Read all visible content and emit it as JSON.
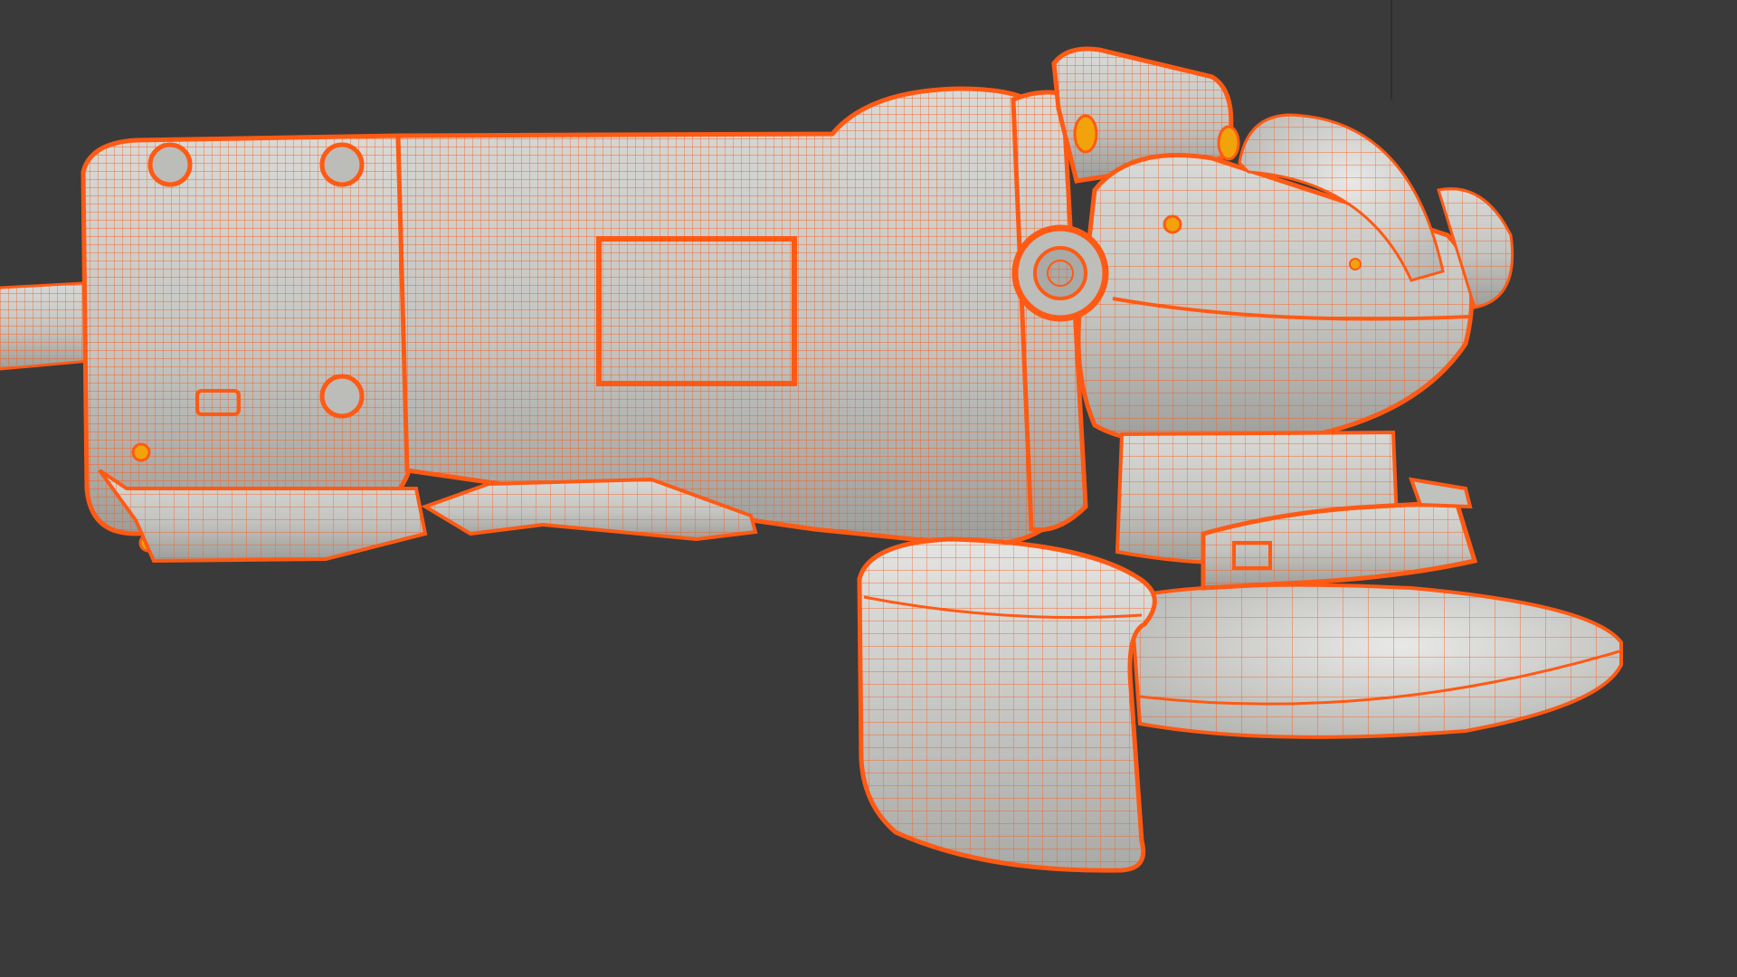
{
  "viewport": {
    "background": "#3a3a3a",
    "mode": "wireframe-on-shaded",
    "object": "angle-grinder",
    "wire_color": "#ff5a14",
    "surface_color": "#c9c9c7",
    "highlight_color": "#f2a20a",
    "selected": true
  }
}
